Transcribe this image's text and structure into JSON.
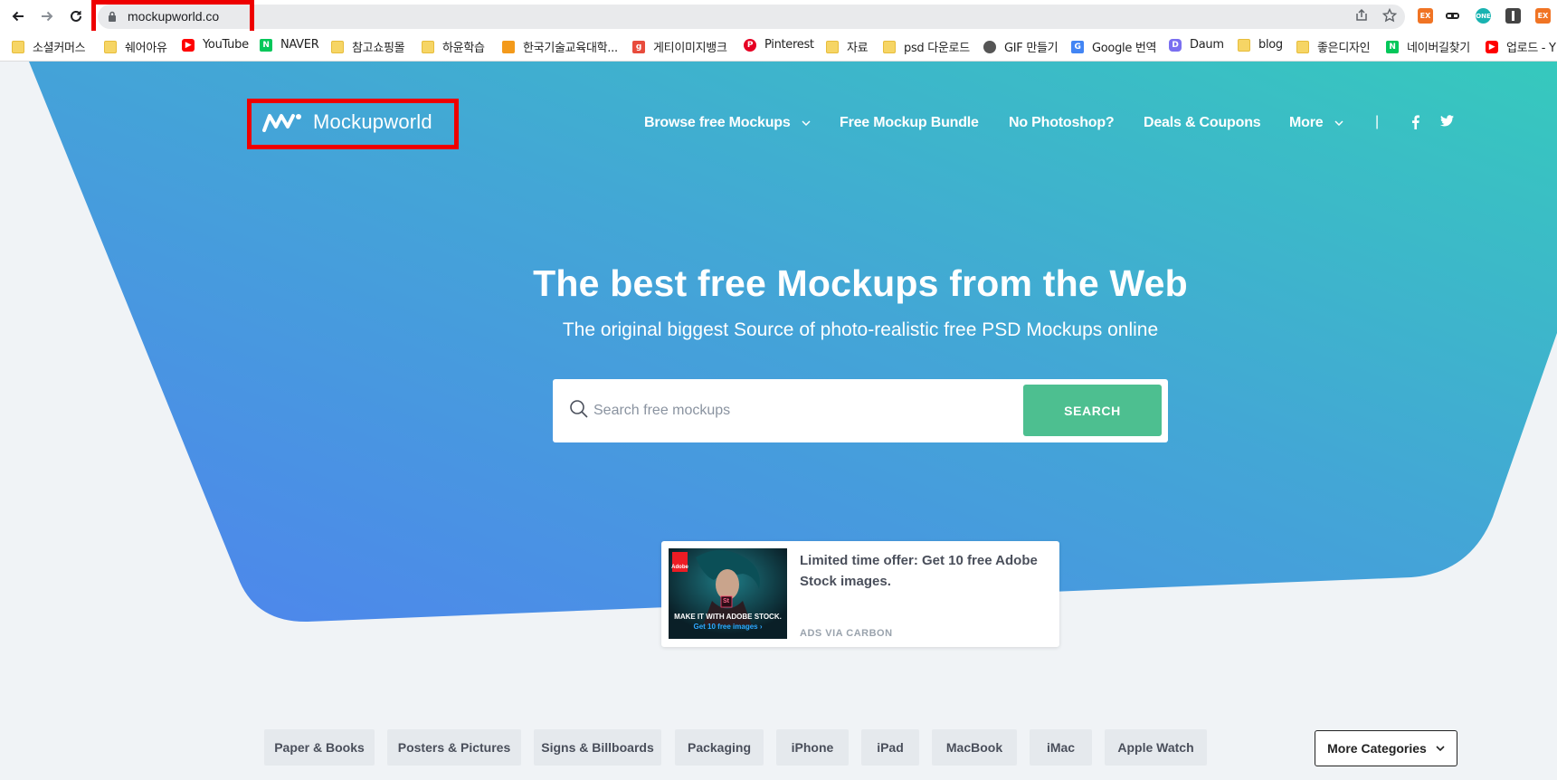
{
  "browser": {
    "url": "mockupworld.co",
    "extensions": [
      "EX",
      "ONE",
      "EX"
    ],
    "bookmarks": [
      {
        "label": "소셜커머스",
        "icon": "folder-icon"
      },
      {
        "label": "쉐어아유",
        "icon": "folder-icon"
      },
      {
        "label": "YouTube",
        "icon": "youtube-icon"
      },
      {
        "label": "NAVER",
        "icon": "naver-icon"
      },
      {
        "label": "참고쇼핑몰",
        "icon": "folder-icon"
      },
      {
        "label": "하윤학습",
        "icon": "folder-icon"
      },
      {
        "label": "한국기술교육대학...",
        "icon": "koreatech-icon"
      },
      {
        "label": "게티이미지뱅크",
        "icon": "gettyimages-icon"
      },
      {
        "label": "Pinterest",
        "icon": "pinterest-icon"
      },
      {
        "label": "자료",
        "icon": "folder-icon"
      },
      {
        "label": "psd 다운로드",
        "icon": "folder-icon"
      },
      {
        "label": "GIF 만들기",
        "icon": "globe-icon"
      },
      {
        "label": "Google 번역",
        "icon": "google-translate-icon"
      },
      {
        "label": "Daum",
        "icon": "daum-icon"
      },
      {
        "label": "blog",
        "icon": "folder-icon"
      },
      {
        "label": "좋은디자인",
        "icon": "folder-icon"
      },
      {
        "label": "네이버길찾기",
        "icon": "naver-icon"
      },
      {
        "label": "업로드 - Y",
        "icon": "youtube-icon"
      }
    ]
  },
  "site": {
    "logo_text": "Mockupworld",
    "nav": {
      "browse": "Browse free Mockups",
      "bundle": "Free Mockup Bundle",
      "no_photoshop": "No Photoshop?",
      "deals": "Deals & Coupons",
      "more": "More",
      "separator": "|"
    }
  },
  "hero": {
    "title": "The best free Mockups from the Web",
    "subtitle": "The original biggest Source of photo-realistic free PSD Mockups online",
    "search_placeholder": "Search free mockups",
    "search_button": "SEARCH"
  },
  "ad": {
    "title": "Limited time offer: Get 10 free Adobe Stock images.",
    "via": "ADS VIA CARBON",
    "image_brand": "Adobe",
    "image_badge": "St",
    "image_caption": "MAKE IT WITH ADOBE STOCK.",
    "image_link": "Get 10 free images ›"
  },
  "categories": [
    "Paper & Books",
    "Posters & Pictures",
    "Signs & Billboards",
    "Packaging",
    "iPhone",
    "iPad",
    "MacBook",
    "iMac",
    "Apple Watch"
  ],
  "more_categories": "More Categories",
  "colors": {
    "hero_gradient_start": "#4f83ee",
    "hero_gradient_end": "#36c9bd",
    "search_button": "#4dbf90",
    "highlight_box": "#ee0000"
  }
}
